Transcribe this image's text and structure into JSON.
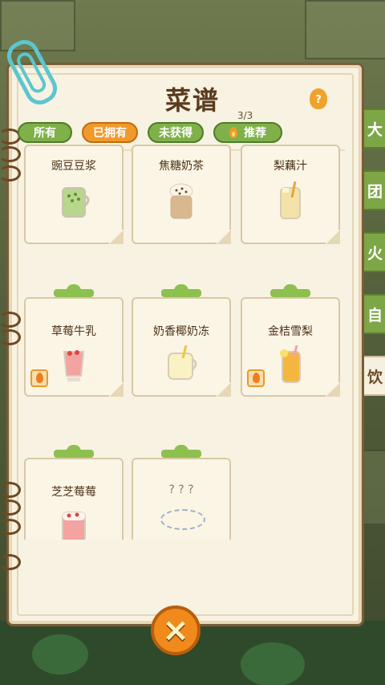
{
  "title": "菜谱",
  "count": "3/3",
  "filters": {
    "all": "所有",
    "owned": "已拥有",
    "not_owned": "未获得",
    "recommend": "推荐"
  },
  "side_tabs": [
    "大",
    "团",
    "火",
    "自",
    "饮"
  ],
  "recipes": [
    {
      "name": "豌豆豆浆",
      "drink": "green",
      "hot": false
    },
    {
      "name": "焦糖奶茶",
      "drink": "cream",
      "hot": false
    },
    {
      "name": "梨藕汁",
      "drink": "pear",
      "hot": false
    },
    {
      "name": "草莓牛乳",
      "drink": "strawberry",
      "hot": true
    },
    {
      "name": "奶香椰奶冻",
      "drink": "coconut",
      "hot": false
    },
    {
      "name": "金桔雪梨",
      "drink": "orange",
      "hot": true
    },
    {
      "name": "芝芝莓莓",
      "drink": "berry",
      "hot": false
    },
    {
      "name": "? ? ?",
      "drink": "unknown",
      "hot": false
    }
  ],
  "close_label": "×",
  "help_label": "?",
  "colors": {
    "accent_green": "#7fb04a",
    "accent_orange": "#f09a2c",
    "paper": "#f8f2e2"
  }
}
